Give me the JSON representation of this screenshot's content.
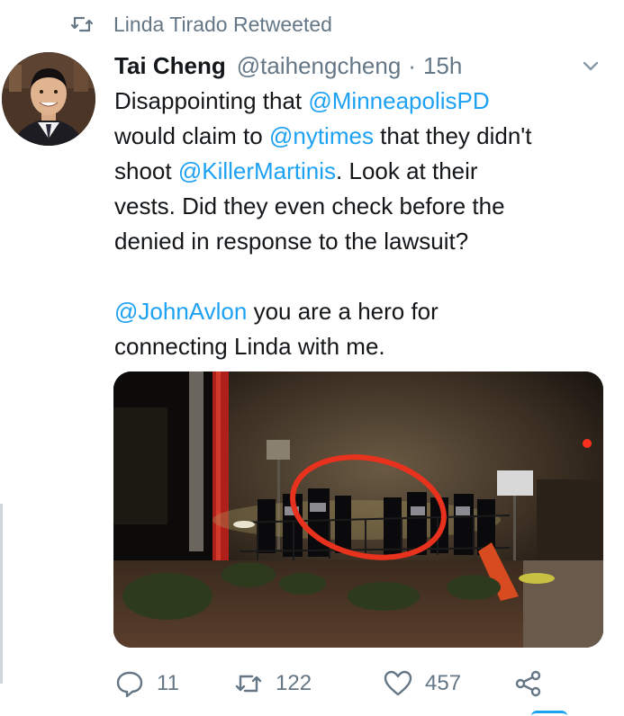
{
  "retweet_banner": "Linda Tirado Retweeted",
  "tweet": {
    "author_name": "Tai Cheng",
    "author_handle": "@taihengcheng",
    "separator": "·",
    "time": "15h",
    "lines": [
      [
        {
          "t": "Disappointing that ",
          "m": false
        },
        {
          "t": "@MinneapolisPD",
          "m": true
        }
      ],
      [
        {
          "t": "would claim to ",
          "m": false
        },
        {
          "t": "@nytimes",
          "m": true
        },
        {
          "t": " that they didn't",
          "m": false
        }
      ],
      [
        {
          "t": "shoot ",
          "m": false
        },
        {
          "t": "@KillerMartinis",
          "m": true
        },
        {
          "t": ".  Look at their",
          "m": false
        }
      ],
      [
        {
          "t": "vests.  Did they even check before the",
          "m": false
        }
      ],
      [
        {
          "t": "denied in response to the lawsuit?",
          "m": false
        }
      ],
      [],
      [
        {
          "t": "@JohnAvlon",
          "m": true
        },
        {
          "t": " you are a hero for",
          "m": false
        }
      ],
      [
        {
          "t": "connecting Linda with me.",
          "m": false
        }
      ]
    ]
  },
  "actions": {
    "reply_count": "11",
    "retweet_count": "122",
    "like_count": "457"
  },
  "icons": {
    "retweet_banner": "retweet-icon",
    "menu": "chevron-down-icon",
    "reply": "reply-icon",
    "retweet": "retweet-icon",
    "like": "heart-icon",
    "share": "share-icon"
  },
  "colors": {
    "mention": "#1da1f2",
    "muted": "#657786",
    "text": "#14171a",
    "annotation_circle": "#e8321e"
  }
}
